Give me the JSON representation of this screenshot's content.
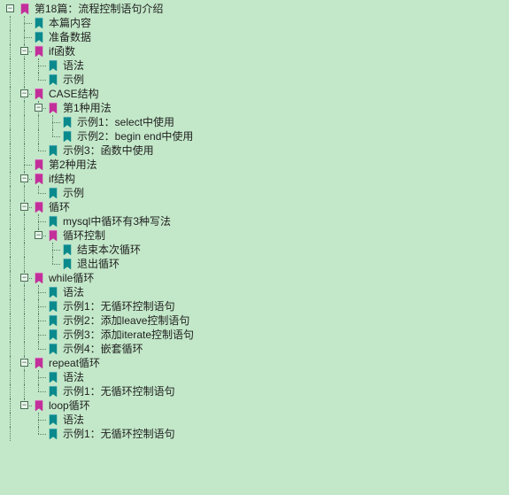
{
  "colors": {
    "magenta": "#c22f9a",
    "teal": "#0a8a8c"
  },
  "toggle": {
    "collapse": "−",
    "expand": "+"
  },
  "tree": {
    "label": "第18篇：流程控制语句介绍",
    "icon": "magenta",
    "expanded": true,
    "children": [
      {
        "label": "本篇内容",
        "icon": "teal"
      },
      {
        "label": "准备数据",
        "icon": "teal"
      },
      {
        "label": "if函数",
        "icon": "magenta",
        "expanded": true,
        "children": [
          {
            "label": "语法",
            "icon": "teal"
          },
          {
            "label": "示例",
            "icon": "teal"
          }
        ]
      },
      {
        "label": "CASE结构",
        "icon": "magenta",
        "expanded": true,
        "children": [
          {
            "label": "第1种用法",
            "icon": "magenta",
            "expanded": true,
            "children": [
              {
                "label": "示例1：select中使用",
                "icon": "teal"
              },
              {
                "label": "示例2：begin end中使用",
                "icon": "teal"
              }
            ]
          },
          {
            "label": "示例3：函数中使用",
            "icon": "teal"
          }
        ]
      },
      {
        "label": "第2种用法",
        "icon": "magenta"
      },
      {
        "label": "if结构",
        "icon": "magenta",
        "expanded": true,
        "children": [
          {
            "label": "示例",
            "icon": "teal"
          }
        ]
      },
      {
        "label": "循环",
        "icon": "magenta",
        "expanded": true,
        "children": [
          {
            "label": "mysql中循环有3种写法",
            "icon": "teal"
          },
          {
            "label": "循环控制",
            "icon": "magenta",
            "expanded": true,
            "children": [
              {
                "label": "结束本次循环",
                "icon": "teal"
              },
              {
                "label": "退出循环",
                "icon": "teal"
              }
            ]
          }
        ]
      },
      {
        "label": "while循环",
        "icon": "magenta",
        "expanded": true,
        "children": [
          {
            "label": "语法",
            "icon": "teal"
          },
          {
            "label": "示例1：无循环控制语句",
            "icon": "teal"
          },
          {
            "label": "示例2：添加leave控制语句",
            "icon": "teal"
          },
          {
            "label": "示例3：添加iterate控制语句",
            "icon": "teal"
          },
          {
            "label": "示例4：嵌套循环",
            "icon": "teal"
          }
        ]
      },
      {
        "label": "repeat循环",
        "icon": "magenta",
        "expanded": true,
        "children": [
          {
            "label": "语法",
            "icon": "teal"
          },
          {
            "label": "示例1：无循环控制语句",
            "icon": "teal"
          }
        ]
      },
      {
        "label": "loop循环",
        "icon": "magenta",
        "expanded": true,
        "children": [
          {
            "label": "语法",
            "icon": "teal"
          },
          {
            "label": "示例1：无循环控制语句",
            "icon": "teal"
          }
        ]
      }
    ]
  }
}
